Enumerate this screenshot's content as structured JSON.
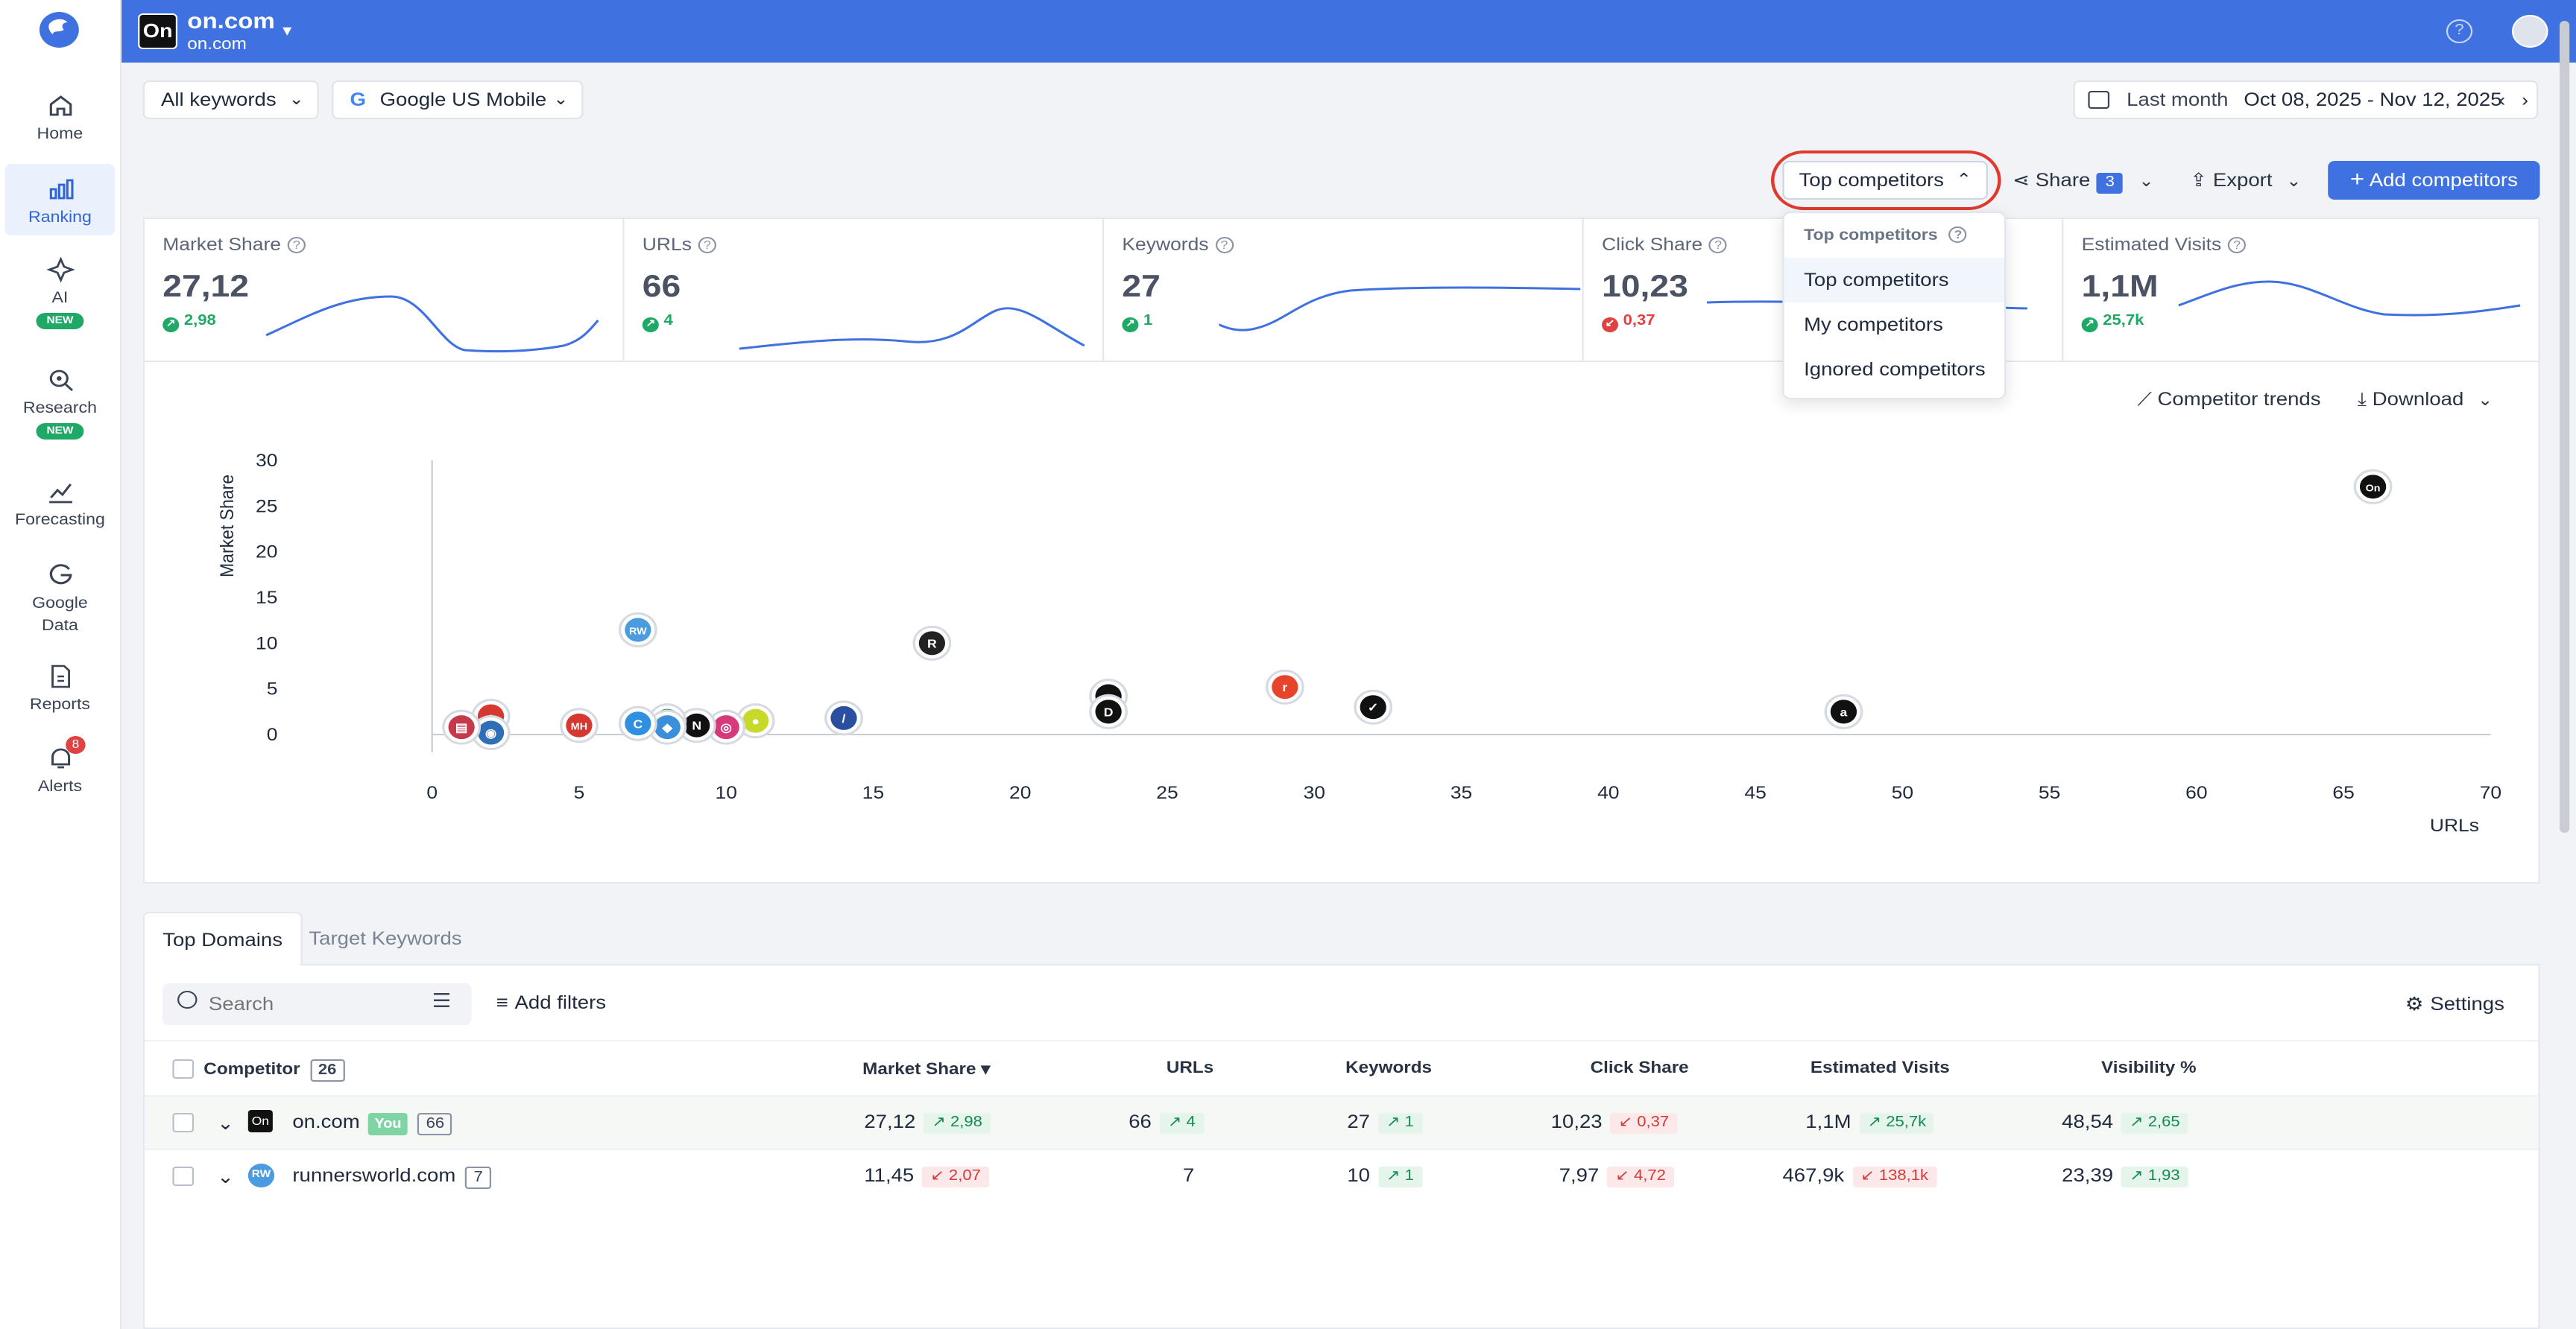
{
  "sidebar": {
    "items": [
      {
        "label": "Home",
        "icon": "home-icon"
      },
      {
        "label": "Ranking",
        "icon": "bar-chart-icon",
        "active": true
      },
      {
        "label": "AI",
        "icon": "sparkle-icon",
        "badge": "NEW"
      },
      {
        "label": "Research",
        "icon": "research-icon",
        "badge": "NEW"
      },
      {
        "label": "Forecasting",
        "icon": "forecast-icon"
      },
      {
        "label": "Google Data",
        "icon": "google-icon"
      },
      {
        "label": "Reports",
        "icon": "report-icon"
      },
      {
        "label": "Alerts",
        "icon": "bell-icon",
        "count": "8"
      }
    ]
  },
  "header": {
    "site_name": "on.com",
    "site_sub": "on.com",
    "accent": "#3f72e0"
  },
  "filters": {
    "keywords": "All keywords",
    "engine": "Google US Mobile",
    "period_label": "Last month",
    "period_range": "Oct 08, 2025 - Nov 12, 2025"
  },
  "toolbar": {
    "competitors": "Top competitors",
    "share": "Share",
    "share_count": "3",
    "export": "Export",
    "add": "Add competitors"
  },
  "kpis": [
    {
      "label": "Market Share",
      "value": "27,12",
      "delta": "2,98",
      "dir": "up"
    },
    {
      "label": "URLs",
      "value": "66",
      "delta": "4",
      "dir": "up"
    },
    {
      "label": "Keywords",
      "value": "27",
      "delta": "1",
      "dir": "up"
    },
    {
      "label": "Click Share",
      "value": "10,23",
      "delta": "0,37",
      "dir": "down"
    },
    {
      "label": "Estimated Visits",
      "value": "1,1M",
      "delta": "25,7k",
      "dir": "up"
    }
  ],
  "dropdown": {
    "header": "Top competitors",
    "options": [
      "Top competitors",
      "My competitors",
      "Ignored competitors"
    ],
    "selected": "Top competitors"
  },
  "chart_actions": {
    "trends": "Competitor trends",
    "download": "Download"
  },
  "chart_data": {
    "type": "scatter",
    "xlabel": "URLs",
    "ylabel": "Market Share",
    "xlim": [
      0,
      70
    ],
    "ylim": [
      0,
      30
    ],
    "xticks": [
      0,
      5,
      10,
      15,
      20,
      25,
      30,
      35,
      40,
      45,
      50,
      55,
      60,
      65,
      70
    ],
    "yticks": [
      0,
      5,
      10,
      15,
      20,
      25,
      30
    ],
    "points": [
      {
        "x": 66,
        "y": 27.12,
        "logo": "On",
        "color": "#111111"
      },
      {
        "x": 7,
        "y": 11.45,
        "logo": "RW",
        "color": "#4b9be0"
      },
      {
        "x": 17,
        "y": 10,
        "logo": "R",
        "color": "#222222"
      },
      {
        "x": 29,
        "y": 5.2,
        "logo": "r",
        "color": "#e6452c"
      },
      {
        "x": 32,
        "y": 3,
        "logo": "✓",
        "color": "#111111"
      },
      {
        "x": 48,
        "y": 2.5,
        "logo": "a",
        "color": "#111111"
      },
      {
        "x": 23,
        "y": 4.2,
        "logo": "▲",
        "color": "#111111"
      },
      {
        "x": 23,
        "y": 2.5,
        "logo": "D",
        "color": "#111111"
      },
      {
        "x": 14,
        "y": 1.8,
        "logo": "/",
        "color": "#2b4fa0"
      },
      {
        "x": 11,
        "y": 1.5,
        "logo": "●",
        "color": "#c8d92a"
      },
      {
        "x": 10,
        "y": 0.8,
        "logo": "◎",
        "color": "#d63a7a"
      },
      {
        "x": 9,
        "y": 1,
        "logo": "N",
        "color": "#111111"
      },
      {
        "x": 8,
        "y": 1.5,
        "logo": "▲",
        "color": "#2a8a56"
      },
      {
        "x": 8,
        "y": 0.8,
        "logo": "◆",
        "color": "#3b8fd8"
      },
      {
        "x": 7,
        "y": 1.2,
        "logo": "C",
        "color": "#2f8fe0"
      },
      {
        "x": 5,
        "y": 1,
        "logo": "MH",
        "color": "#d6372e"
      },
      {
        "x": 2,
        "y": 2,
        "logo": "●",
        "color": "#d6372e"
      },
      {
        "x": 2,
        "y": 0.2,
        "logo": "◉",
        "color": "#2f6fb8"
      },
      {
        "x": 1,
        "y": 0.8,
        "logo": "▤",
        "color": "#c43a4a"
      }
    ]
  },
  "table": {
    "tabs": [
      "Top Domains",
      "Target Keywords"
    ],
    "search_placeholder": "Search",
    "add_filters": "Add filters",
    "settings": "Settings",
    "headers": {
      "competitor": "Competitor",
      "competitor_count": "26",
      "market_share": "Market Share",
      "urls": "URLs",
      "keywords": "Keywords",
      "click_share": "Click Share",
      "visits": "Estimated Visits",
      "visibility": "Visibility %"
    },
    "rows": [
      {
        "domain": "on.com",
        "you": "You",
        "count": "66",
        "ms": "27,12",
        "ms_d": "2,98",
        "ms_dir": "up",
        "urls": "66",
        "urls_d": "4",
        "urls_dir": "up",
        "kw": "27",
        "kw_d": "1",
        "kw_dir": "up",
        "cs": "10,23",
        "cs_d": "0,37",
        "cs_dir": "down",
        "ev": "1,1M",
        "ev_d": "25,7k",
        "ev_dir": "up",
        "vis": "48,54",
        "vis_d": "2,65",
        "vis_dir": "up"
      },
      {
        "domain": "runnersworld.com",
        "you": "",
        "count": "7",
        "ms": "11,45",
        "ms_d": "2,07",
        "ms_dir": "down",
        "urls": "7",
        "urls_d": "",
        "urls_dir": "",
        "kw": "10",
        "kw_d": "1",
        "kw_dir": "up",
        "cs": "7,97",
        "cs_d": "4,72",
        "cs_dir": "down",
        "ev": "467,9k",
        "ev_d": "138,1k",
        "ev_dir": "down",
        "vis": "23,39",
        "vis_d": "1,93",
        "vis_dir": "up"
      }
    ]
  }
}
